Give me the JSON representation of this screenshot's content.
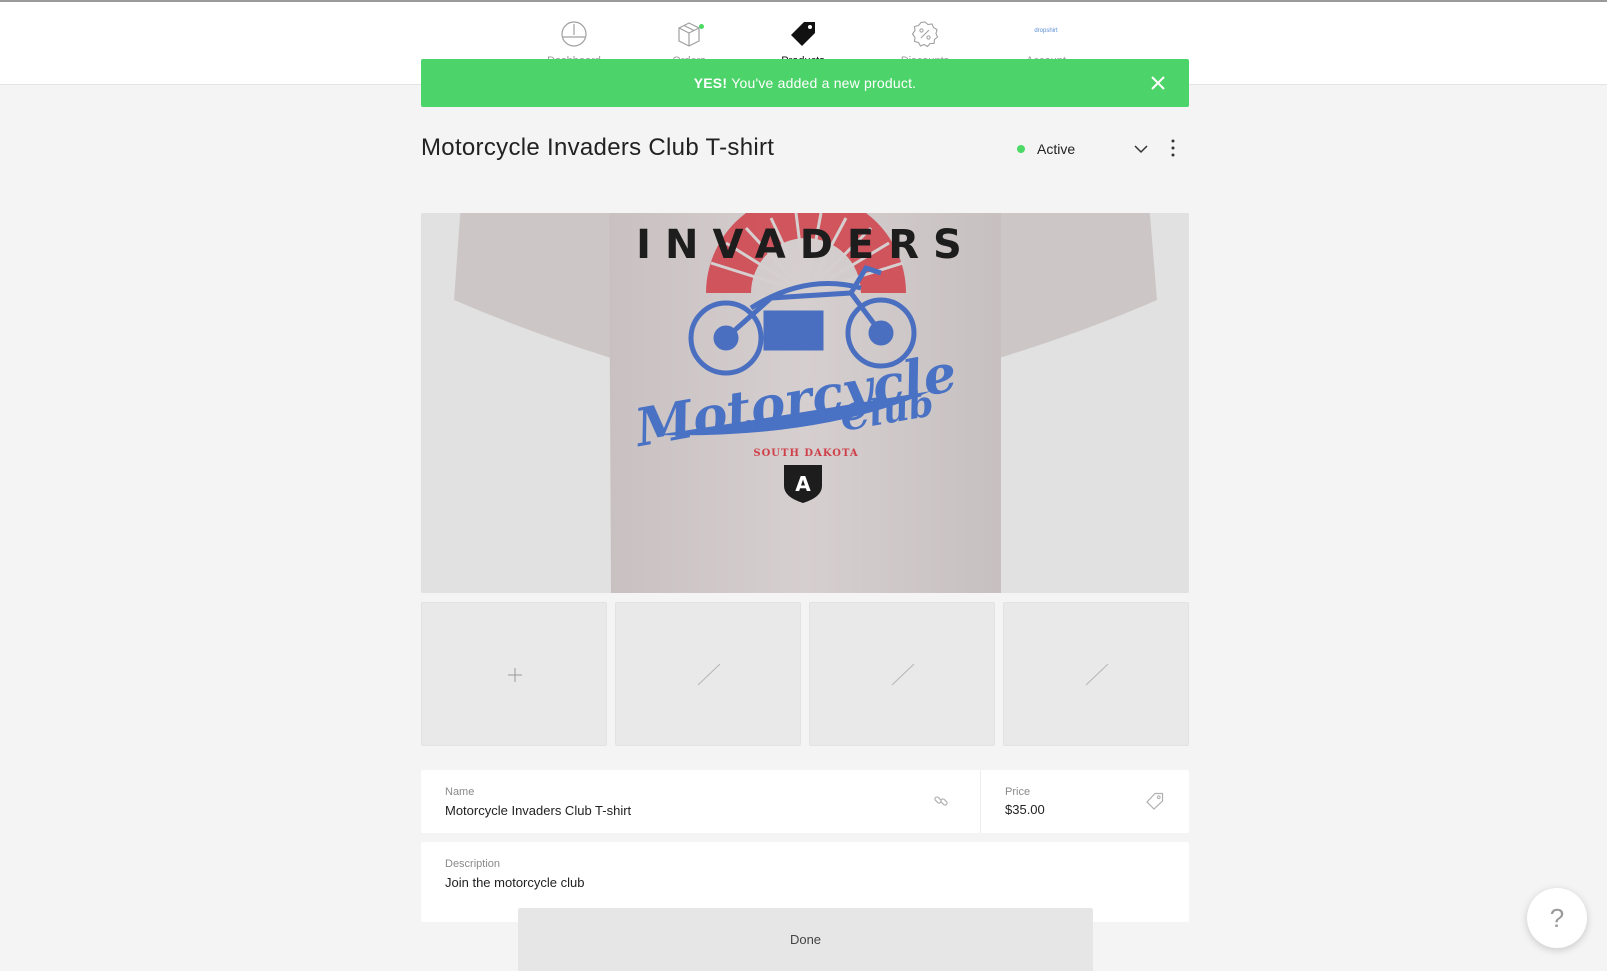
{
  "nav": {
    "items": [
      {
        "label": "Dashboard",
        "icon": "dashboard-gauge-icon"
      },
      {
        "label": "Orders",
        "icon": "box-icon"
      },
      {
        "label": "Products",
        "icon": "tag-icon",
        "active": true
      },
      {
        "label": "Discounts",
        "icon": "percent-badge-icon"
      },
      {
        "label": "Account",
        "icon": "store-logo"
      }
    ],
    "account_logo_text": "dropshirt"
  },
  "banner": {
    "strong": "YES!",
    "message": "You've added a new product.",
    "color": "#4cd36a"
  },
  "product": {
    "title": "Motorcycle Invaders Club T-shirt",
    "status": "Active",
    "status_color": "#4cd964",
    "shirt_print": {
      "top_text": "INVADERS",
      "script_line1": "Motorcycle",
      "script_line2": "Club",
      "state": "SOUTH DAKOTA",
      "badge": "A"
    }
  },
  "fields": {
    "name_label": "Name",
    "name_value": "Motorcycle Invaders Club T-shirt",
    "price_label": "Price",
    "price_value": "$35.00",
    "description_label": "Description",
    "description_value": "Join the motorcycle club"
  },
  "actions": {
    "done_label": "Done",
    "help_label": "?"
  }
}
